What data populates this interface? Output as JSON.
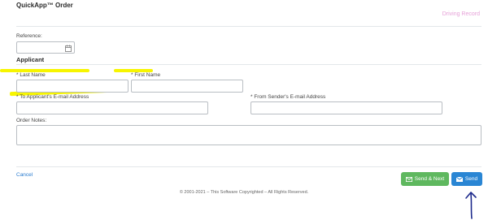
{
  "header": {
    "title": "QuickApp™ Order",
    "product": "Driving Record"
  },
  "reference": {
    "label": "Reference:",
    "value": ""
  },
  "applicant": {
    "heading": "Applicant",
    "last_name_label": "* Last Name",
    "first_name_label": "* First Name",
    "to_email_label": "* To Applicant's E-mail Address",
    "from_email_label": "* From Sender's E-mail Address",
    "notes_label": "Order Notes:"
  },
  "actions": {
    "cancel": "Cancel",
    "send_next": "Send & Next",
    "send": "Send"
  },
  "footer": "© 2001-2021 – This Software Copyrighted – All Rights Reserved.",
  "colors": {
    "highlight": "#f7f500",
    "send": "#2a86d4",
    "send_next": "#5fb85f",
    "product": "#e6a1d8",
    "annotation_arrow": "#1d2a8c"
  },
  "icons": {
    "reference": "calendar-icon",
    "send_next": "envelope-icon",
    "send": "envelope-icon",
    "annotation": "arrow-up-icon"
  }
}
